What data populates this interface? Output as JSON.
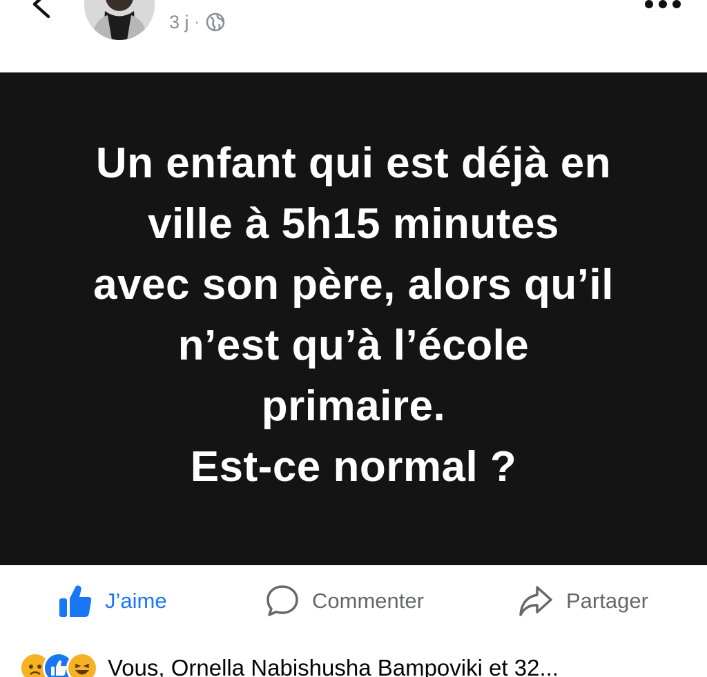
{
  "header": {
    "time_ago": "3 j",
    "separator": "·",
    "visibility_icon": "globe-icon",
    "back_icon": "chevron-left-icon",
    "more_icon": "more-dots-icon"
  },
  "post": {
    "lines": [
      "Un enfant qui est déjà en",
      "ville à 5h15 minutes",
      "avec son père, alors qu’il",
      "n’est qu’à l’école",
      "primaire.",
      "Est-ce normal ?"
    ],
    "background_color": "#141414",
    "text_color": "#ffffff"
  },
  "actions": {
    "like_label": "J’aime",
    "comment_label": "Commenter",
    "share_label": "Partager",
    "like_color": "#1877f2",
    "icon_like": "thumbs-up-icon",
    "icon_comment": "comment-bubble-icon",
    "icon_share": "share-arrow-icon"
  },
  "reactions": {
    "icons": [
      "sad-emoji-icon",
      "like-reaction-icon",
      "haha-emoji-icon"
    ],
    "summary": "Vous, Ornella Nabishusha Bampoviki et 32..."
  }
}
